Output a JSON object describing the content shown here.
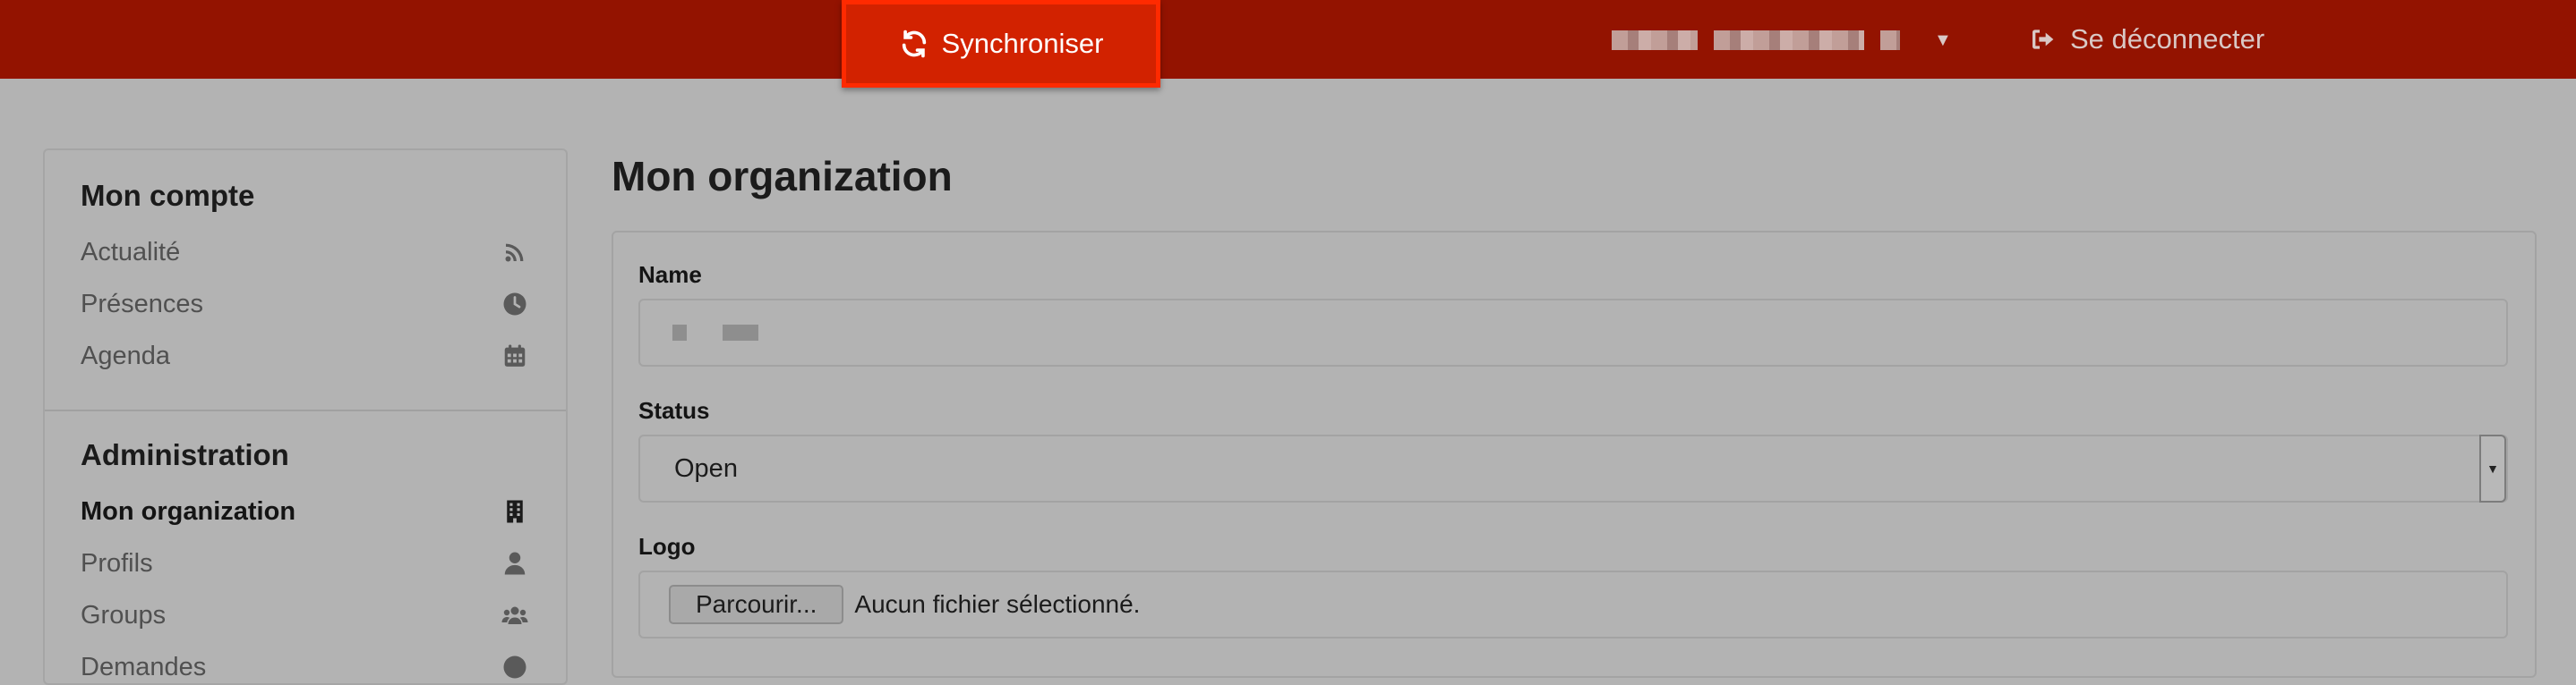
{
  "topbar": {
    "sync_label": "Synchroniser",
    "logout_label": "Se déconnecter"
  },
  "sidebar": {
    "sections": [
      {
        "title": "Mon compte",
        "items": [
          {
            "label": "Actualité",
            "icon": "rss-icon"
          },
          {
            "label": "Présences",
            "icon": "clock-icon"
          },
          {
            "label": "Agenda",
            "icon": "calendar-icon"
          }
        ]
      },
      {
        "title": "Administration",
        "items": [
          {
            "label": "Mon organization",
            "icon": "building-icon",
            "active": true
          },
          {
            "label": "Profils",
            "icon": "user-icon"
          },
          {
            "label": "Groups",
            "icon": "users-icon"
          },
          {
            "label": "Demandes",
            "icon": "question-icon"
          }
        ]
      }
    ]
  },
  "main": {
    "title": "Mon organization",
    "fields": {
      "name_label": "Name",
      "status_label": "Status",
      "status_value": "Open",
      "logo_label": "Logo",
      "browse_label": "Parcourir...",
      "no_file_text": "Aucun fichier sélectionné."
    }
  },
  "colors": {
    "topbar": "#931300",
    "sync_button": "#d22200",
    "sync_highlight": "#ff2a00",
    "background": "#b3b3b3"
  }
}
